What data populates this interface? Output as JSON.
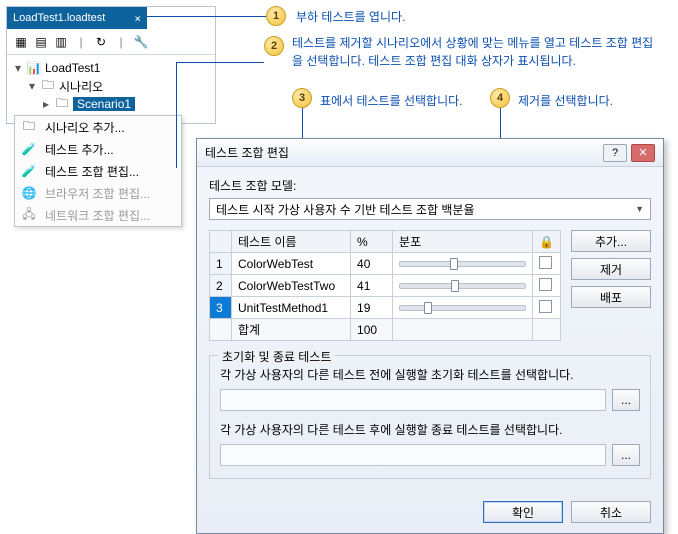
{
  "tool_window": {
    "tab_title": "LoadTest1.loadtest",
    "root": "LoadTest1",
    "node_scenario": "시나리오",
    "selected_node": "Scenario1"
  },
  "context_menu": {
    "items": [
      {
        "label": "시나리오 추가..."
      },
      {
        "label": "테스트 추가..."
      },
      {
        "label": "테스트 조합 편집..."
      },
      {
        "label": "브라우저 조합 편집..."
      },
      {
        "label": "네트워크 조합 편집..."
      }
    ]
  },
  "callouts": {
    "c1": "부하 테스트를 엽니다.",
    "c2": "테스트를 제거할 시나리오에서 상황에 맞는 메뉴를 열고 테스트 조합 편집을 선택합니다. 테스트 조합 편집 대화 상자가 표시됩니다.",
    "c3": "표에서 테스트를 선택합니다.",
    "c4": "제거를 선택합니다."
  },
  "dialog": {
    "title": "테스트 조합 편집",
    "model_label": "테스트 조합 모델:",
    "model_value": "테스트 시작 가상 사용자 수 기반 테스트 조합 백분율",
    "columns": {
      "name": "테스트 이름",
      "pct": "%",
      "dist": "분포",
      "lock_icon": "🔒"
    },
    "rows": [
      {
        "num": "1",
        "name": "ColorWebTest",
        "pct": "40"
      },
      {
        "num": "2",
        "name": "ColorWebTestTwo",
        "pct": "41"
      },
      {
        "num": "3",
        "name": "UnitTestMethod1",
        "pct": "19"
      }
    ],
    "total_label": "합계",
    "total_value": "100",
    "buttons": {
      "add": "추가...",
      "remove": "제거",
      "distribute": "배포"
    },
    "group_legend": "초기화 및 종료 테스트",
    "init_label": "각 가상 사용자의 다른 테스트 전에 실행할 초기화 테스트를 선택합니다.",
    "term_label": "각 가상 사용자의 다른 테스트 후에 실행할 종료 테스트를 선택합니다.",
    "dots": "...",
    "ok": "확인",
    "cancel": "취소"
  }
}
